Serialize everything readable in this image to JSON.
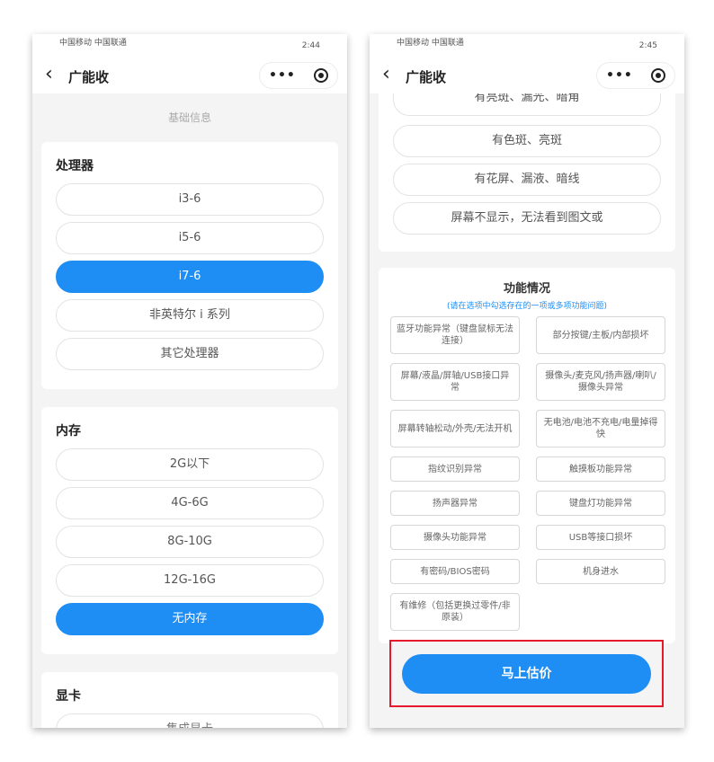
{
  "left_phone": {
    "status": {
      "carrier": "中国移动 中国联通",
      "time": "2:44"
    },
    "nav": {
      "title": "广能收"
    },
    "section_label": "基础信息",
    "processor": {
      "title": "处理器",
      "options": [
        "i3-6",
        "i5-6",
        "i7-6",
        "非英特尔 i 系列",
        "其它处理器"
      ],
      "selected_index": 2
    },
    "memory": {
      "title": "内存",
      "options": [
        "2G以下",
        "4G-6G",
        "8G-10G",
        "12G-16G",
        "无内存"
      ],
      "selected_index": 4
    },
    "graphics": {
      "title": "显卡",
      "partial_option": "集成显卡"
    }
  },
  "right_phone": {
    "status": {
      "carrier": "中国移动 中国联通",
      "time": "2:45"
    },
    "nav": {
      "title": "广能收"
    },
    "screen_options": [
      "有亮斑、漏光、暗角",
      "有色斑、亮斑",
      "有花屏、漏液、暗线",
      "屏幕不显示，无法看到图文或"
    ],
    "function": {
      "title": "功能情况",
      "subtitle": "(请在选项中勾选存在的一项或多项功能问题)",
      "items": [
        {
          "label": "蓝牙功能异常（键盘鼠标无法连接）",
          "tall": true
        },
        {
          "label": "部分按键/主板/内部损坏",
          "tall": true
        },
        {
          "label": "屏幕/液晶/屏轴/USB接口异常",
          "tall": true
        },
        {
          "label": "摄像头/麦克风/扬声器/喇叭/摄像头异常",
          "tall": true
        },
        {
          "label": "屏幕转轴松动/外壳/无法开机",
          "tall": true
        },
        {
          "label": "无电池/电池不充电/电量掉得快",
          "tall": true
        },
        {
          "label": "指纹识别异常",
          "tall": false
        },
        {
          "label": "触摸板功能异常",
          "tall": false
        },
        {
          "label": "扬声器异常",
          "tall": false
        },
        {
          "label": "键盘灯功能异常",
          "tall": false
        },
        {
          "label": "摄像头功能异常",
          "tall": false
        },
        {
          "label": "USB等接口损坏",
          "tall": false
        },
        {
          "label": "有密码/BIOS密码",
          "tall": false
        },
        {
          "label": "机身进水",
          "tall": false
        },
        {
          "label": "有维修（包括更换过零件/非原装）",
          "tall": true
        }
      ]
    },
    "cta": {
      "label": "马上估价"
    }
  },
  "colors": {
    "accent": "#1e8ef5",
    "highlight_frame": "#e5192b"
  }
}
